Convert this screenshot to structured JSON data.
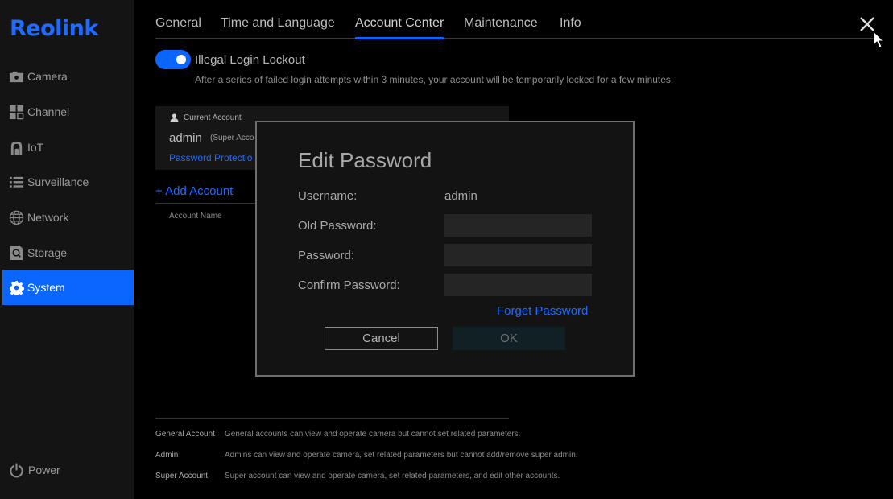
{
  "brand": {
    "logo": "Reolink",
    "accent": "#0a66ff"
  },
  "sidebar": {
    "items": [
      {
        "label": "Camera",
        "icon": "camera-icon",
        "active": false
      },
      {
        "label": "Channel",
        "icon": "channel-grid-icon",
        "active": false
      },
      {
        "label": "IoT",
        "icon": "iot-icon",
        "active": false
      },
      {
        "label": "Surveillance",
        "icon": "list-icon",
        "active": false
      },
      {
        "label": "Network",
        "icon": "globe-icon",
        "active": false
      },
      {
        "label": "Storage",
        "icon": "storage-icon",
        "active": false
      },
      {
        "label": "System",
        "icon": "gear-icon",
        "active": true
      }
    ],
    "power_label": "Power"
  },
  "tabs": [
    {
      "label": "General",
      "active": false
    },
    {
      "label": "Time and Language",
      "active": false
    },
    {
      "label": "Account Center",
      "active": true
    },
    {
      "label": "Maintenance",
      "active": false
    },
    {
      "label": "Info",
      "active": false
    }
  ],
  "lockout": {
    "enabled": true,
    "title": "Illegal Login Lockout",
    "description": "After a series of failed login attempts within 3 minutes, your account will be temporarily locked for a few minutes."
  },
  "current_account": {
    "label": "Current Account",
    "name": "admin",
    "role": "(Super Acco",
    "password_protection": "Password Protectio"
  },
  "accounts": {
    "add_label": "+ Add Account",
    "columns": [
      "Account Name"
    ]
  },
  "legend": [
    {
      "term": "General Account",
      "definition": "General accounts can view and operate camera but cannot set related parameters."
    },
    {
      "term": "Admin",
      "definition": "Admins can view and operate camera, set related parameters but cannot add/remove super admin."
    },
    {
      "term": "Super Account",
      "definition": "Super account can view and operate camera, set related parameters, and edit other accounts."
    }
  ],
  "modal": {
    "title": "Edit Password",
    "username_label": "Username:",
    "username_value": "admin",
    "old_password_label": "Old Password:",
    "old_password_value": "",
    "password_label": "Password:",
    "password_value": "",
    "confirm_label": "Confirm Password:",
    "confirm_value": "",
    "forget_label": "Forget Password",
    "cancel_label": "Cancel",
    "ok_label": "OK"
  }
}
